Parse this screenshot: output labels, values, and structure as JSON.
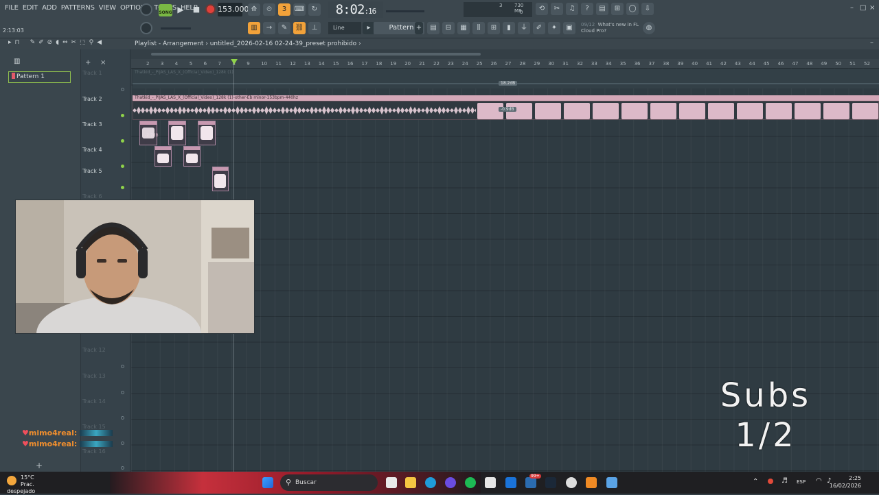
{
  "menu": [
    "FILE",
    "EDIT",
    "ADD",
    "PATTERNS",
    "VIEW",
    "OPTIONS",
    "TOOLS",
    "HELP"
  ],
  "transport": {
    "song_mode_label": "SONG",
    "tempo": "153.000",
    "clock_main": "8:02",
    "clock_sub": ":16",
    "time_left": "2:13:03",
    "cpu_ram": "730 MB",
    "cpu_count": "3",
    "cpu_zero": "0"
  },
  "toolbar2": {
    "snap_mode": "Line",
    "pattern_selector": "Pattern 1",
    "news_date": "09/12",
    "news_title": "What's new in FL",
    "news_subtitle": "Cloud Pro?"
  },
  "playlist": {
    "title": "Playlist - Arrangement",
    "project": "untitled_2026-02-16 02-24-39_preset prohibido",
    "picker_pattern": "Pattern 1",
    "ruler": [
      "2",
      "3",
      "4",
      "5",
      "6",
      "7",
      "8",
      "9",
      "10",
      "11",
      "12",
      "13",
      "14",
      "15",
      "16",
      "17",
      "18",
      "19",
      "20",
      "21",
      "22",
      "23",
      "24",
      "25",
      "26",
      "27",
      "28",
      "29",
      "30",
      "31",
      "32",
      "33",
      "34",
      "35",
      "36",
      "37",
      "38",
      "39",
      "40",
      "41",
      "42",
      "43",
      "44",
      "45",
      "46",
      "47",
      "48",
      "49",
      "50",
      "51",
      "52"
    ],
    "tracks": [
      {
        "name": "Track 1",
        "dim": true
      },
      {
        "name": "Track 2",
        "dim": false
      },
      {
        "name": "Track 3",
        "dim": false
      },
      {
        "name": "Track 4",
        "dim": false
      },
      {
        "name": "Track 5",
        "dim": false
      },
      {
        "name": "Track 6",
        "dim": true
      },
      {
        "name": "Track 12",
        "dim": true
      },
      {
        "name": "Track 13",
        "dim": true
      },
      {
        "name": "Track 14",
        "dim": true
      },
      {
        "name": "Track 15",
        "dim": true
      },
      {
        "name": "Track 16",
        "dim": true
      }
    ],
    "clip_track1_label": "Thatkid_-_PIJAS_LAS_X_(Official_Video)_128k (1)",
    "clip_track1_db": "18.2dB",
    "clip_track2_label": "Thatkid_-_PIJAS_LAS_X_(Official_Video)_128k (1)-other-Eb minor-153bpm-440hz",
    "clip_track2_db": "-0.9dB",
    "clip_track3_db": "-2.7dB"
  },
  "overlay": {
    "subs_line1": "Subs",
    "subs_line2": "1/2",
    "viewers": [
      "mimo4real:",
      "mimo4real:"
    ]
  },
  "taskbar": {
    "temperature": "15°C",
    "weather": "Prac. despejado",
    "search_placeholder": "Buscar",
    "badge": "99+",
    "language": "ESP",
    "time": "2:25",
    "date": "16/02/2026"
  },
  "colors": {
    "accent_orange": "#f2a23a",
    "song_green": "#7ab844",
    "clip_pink": "#c89aac",
    "record_red": "#e0403a"
  }
}
